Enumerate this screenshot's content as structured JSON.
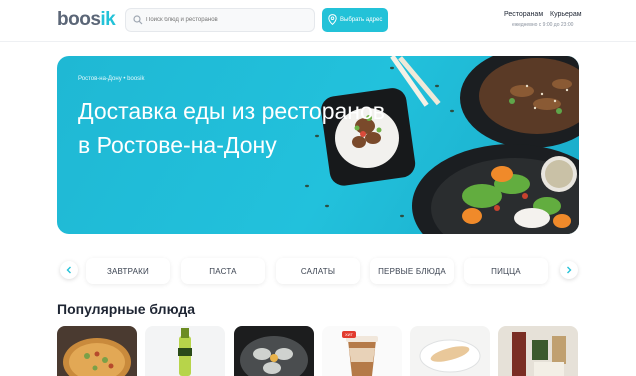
{
  "header": {
    "logo_main": "boos",
    "logo_accent": "ik",
    "search_placeholder": "Поиск блюд и ресторанов",
    "address_button": "Выбрать адрес",
    "nav": {
      "restaurants": "Ресторанам",
      "couriers": "Курьерам"
    },
    "hours": "ежедневно с 9:00 до 23:00"
  },
  "hero": {
    "breadcrumb": "Ростов-на-Дону • boosik",
    "title": "Доставка еды из ресторанов в Ростове-на-Дону"
  },
  "categories": [
    "ЗАВТРАКИ",
    "ПАСТА",
    "САЛАТЫ",
    "ПЕРВЫЕ БЛЮДА",
    "ПИЦЦА"
  ],
  "popular": {
    "title": "Популярные блюда",
    "dishes": [
      {
        "name": "pizza"
      },
      {
        "name": "drink"
      },
      {
        "name": "oysters"
      },
      {
        "name": "latte"
      },
      {
        "name": "crepe"
      },
      {
        "name": "set"
      }
    ],
    "latte_badge": "ХИТ"
  },
  "colors": {
    "accent": "#23c2d8",
    "text": "#1e2533"
  }
}
